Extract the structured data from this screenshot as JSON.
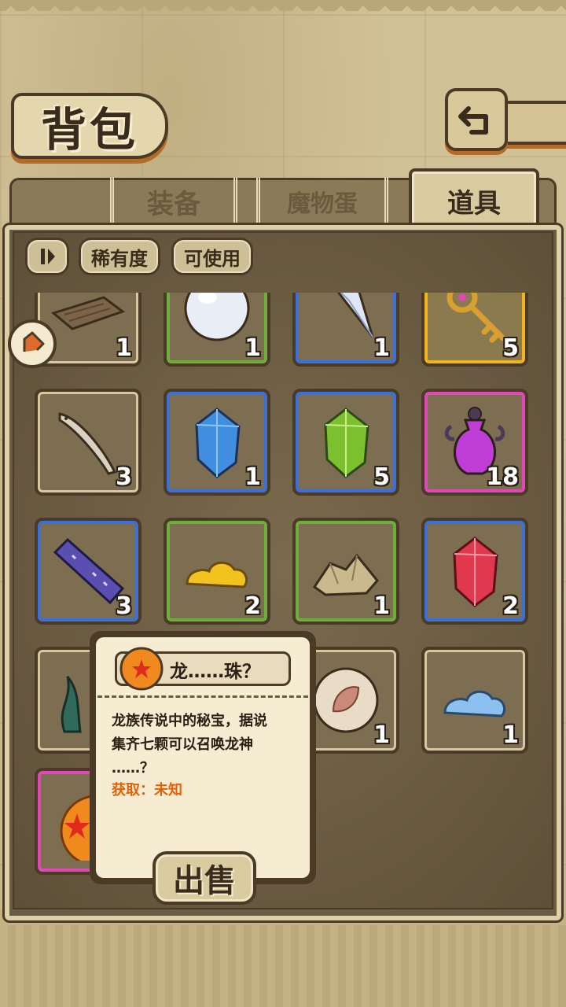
{
  "title": "背包",
  "tabs": [
    {
      "label": "装备",
      "active": false
    },
    {
      "label": "魔物蛋",
      "active": false
    },
    {
      "label": "道具",
      "active": true
    }
  ],
  "filters": {
    "toggle_icon": "pause-icon",
    "rarity_label": "稀有度",
    "usable_label": "可使用"
  },
  "items": [
    {
      "name": "wood-plank",
      "rarity": "common",
      "count": "1"
    },
    {
      "name": "pearl",
      "rarity": "green",
      "count": "1"
    },
    {
      "name": "crystal-shard",
      "rarity": "blue",
      "count": "1"
    },
    {
      "name": "golden-key",
      "rarity": "gold",
      "count": "5"
    },
    {
      "name": "fish",
      "rarity": "common",
      "count": "3"
    },
    {
      "name": "blue-crystal",
      "rarity": "blue",
      "count": "1"
    },
    {
      "name": "green-crystal",
      "rarity": "blue",
      "count": "5"
    },
    {
      "name": "purple-potion",
      "rarity": "purple",
      "count": "18"
    },
    {
      "name": "purple-bar",
      "rarity": "blue",
      "count": "3"
    },
    {
      "name": "yellow-slime",
      "rarity": "green",
      "count": "2"
    },
    {
      "name": "ore-pile",
      "rarity": "green",
      "count": "1"
    },
    {
      "name": "red-crystal",
      "rarity": "blue",
      "count": "2"
    },
    {
      "name": "seaweed",
      "rarity": "common",
      "count": ""
    },
    {
      "name": "hidden",
      "rarity": "common",
      "count": ""
    },
    {
      "name": "leaf-orb",
      "rarity": "common",
      "count": "1"
    },
    {
      "name": "blue-slime",
      "rarity": "common",
      "count": "1"
    },
    {
      "name": "dragon-ball",
      "rarity": "purple",
      "count": ""
    }
  ],
  "tooltip": {
    "item_name": "龙……珠？",
    "description": "龙族传说中的秘宝，据说\n集齐七颗可以召唤龙神\n……？",
    "obtain_label": "获取：未知",
    "sell_label": "出售"
  },
  "colors": {
    "common": "#d7c99f",
    "green": "#6fae3a",
    "blue": "#3d6fd8",
    "gold": "#f2b31e",
    "purple": "#e048b8",
    "obtain": "#e0620a"
  }
}
